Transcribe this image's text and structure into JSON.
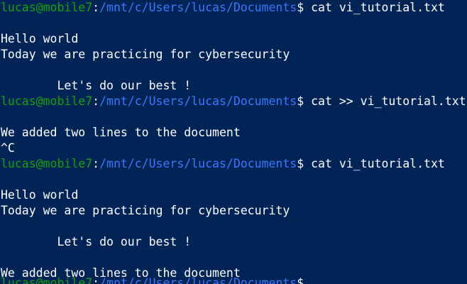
{
  "colors": {
    "background": "#012456",
    "prompt_user": "#13a10e",
    "prompt_path": "#3b78ff",
    "text": "#ffffff"
  },
  "prompt": {
    "user_host": "lucas@mobile7",
    "separator": ":",
    "path": "/mnt/c/Users/lucas/Documents",
    "symbol": "$ "
  },
  "commands": [
    "cat vi_tutorial.txt",
    "cat >> vi_tutorial.txt",
    "cat vi_tutorial.txt"
  ],
  "output": {
    "block1": [
      "Hello world",
      "Today we are practicing for cybersecurity",
      "        Let's do our best !"
    ],
    "block2": [
      "We added two lines to the document",
      "^C"
    ],
    "block3": [
      "Hello world",
      "Today we are practicing for cybersecurity",
      "        Let's do our best !",
      "We added two lines to the document"
    ]
  }
}
